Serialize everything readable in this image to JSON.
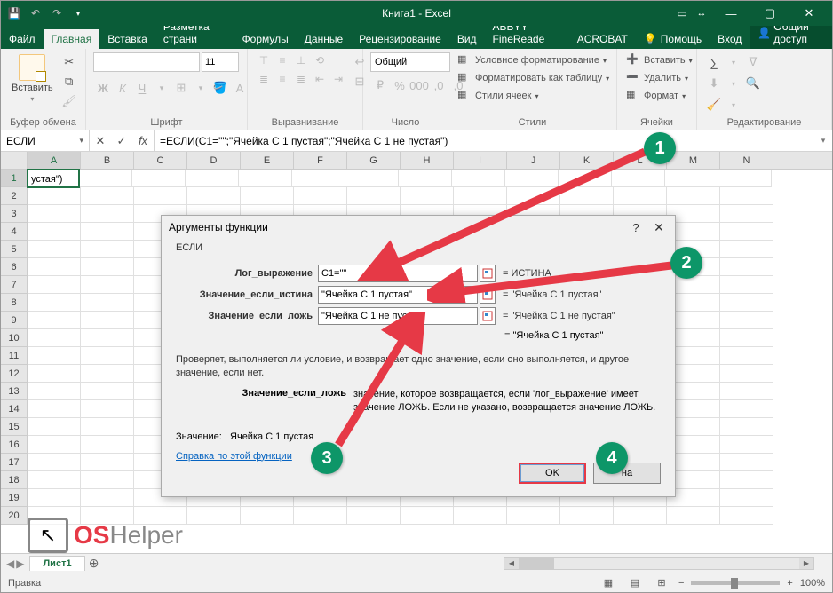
{
  "titlebar": {
    "title": "Книга1 - Excel"
  },
  "tabs": {
    "file": "Файл",
    "list": [
      "Главная",
      "Вставка",
      "Разметка страни",
      "Формулы",
      "Данные",
      "Рецензирование",
      "Вид",
      "ABBYY FineReade",
      "ACROBAT"
    ],
    "active": 0,
    "help": "Помощь",
    "login": "Вход",
    "share": "Общий доступ"
  },
  "ribbon": {
    "clipboard": {
      "paste": "Вставить",
      "label": "Буфер обмена"
    },
    "font": {
      "family": "",
      "size": "11",
      "label": "Шрифт"
    },
    "align": {
      "label": "Выравнивание"
    },
    "number": {
      "format": "Общий",
      "label": "Число"
    },
    "styles": {
      "cond": "Условное форматирование",
      "table": "Форматировать как таблицу",
      "cell": "Стили ячеек",
      "label": "Стили"
    },
    "cells": {
      "insert": "Вставить",
      "delete": "Удалить",
      "format": "Формат",
      "label": "Ячейки"
    },
    "editing": {
      "label": "Редактирование"
    }
  },
  "formulaBar": {
    "nameBox": "ЕСЛИ",
    "formula": "=ЕСЛИ(C1=\"\";\"Ячейка С 1 пустая\";\"Ячейка С 1 не пустая\")"
  },
  "grid": {
    "cols": [
      "A",
      "B",
      "C",
      "D",
      "E",
      "F",
      "G",
      "H",
      "I",
      "J",
      "K",
      "L",
      "M",
      "N"
    ],
    "a1": "устая\")"
  },
  "dialog": {
    "title": "Аргументы функции",
    "func": "ЕСЛИ",
    "args": [
      {
        "label": "Лог_выражение",
        "value": "C1=\"\"",
        "result": "= ИСТИНА"
      },
      {
        "label": "Значение_если_истина",
        "value": "\"Ячейка С 1 пустая\"",
        "result": "= \"Ячейка С 1 пустая\""
      },
      {
        "label": "Значение_если_ложь",
        "value": "\"Ячейка С 1 не пустая\"",
        "result": "= \"Ячейка С 1 не пустая\""
      }
    ],
    "evalResult": "= \"Ячейка С 1 пустая\"",
    "desc": "Проверяет, выполняется ли условие, и возвращает одно значение, если оно выполняется, и другое значение, если нет.",
    "argDescLabel": "Значение_если_ложь",
    "argDescText": "значение, которое возвращается, если 'лог_выражение' имеет значение ЛОЖЬ. Если не указано, возвращается значение ЛОЖЬ.",
    "resultLabel": "Значение:",
    "resultValue": "Ячейка С 1 пустая",
    "helpLink": "Справка по этой функции",
    "ok": "OK",
    "cancel": "на"
  },
  "sheetTab": "Лист1",
  "status": {
    "mode": "Правка",
    "zoom": "100%"
  },
  "markers": {
    "m1": "1",
    "m2": "2",
    "m3": "3",
    "m4": "4"
  },
  "logo": {
    "os": "OS",
    "helper": " Helper"
  }
}
